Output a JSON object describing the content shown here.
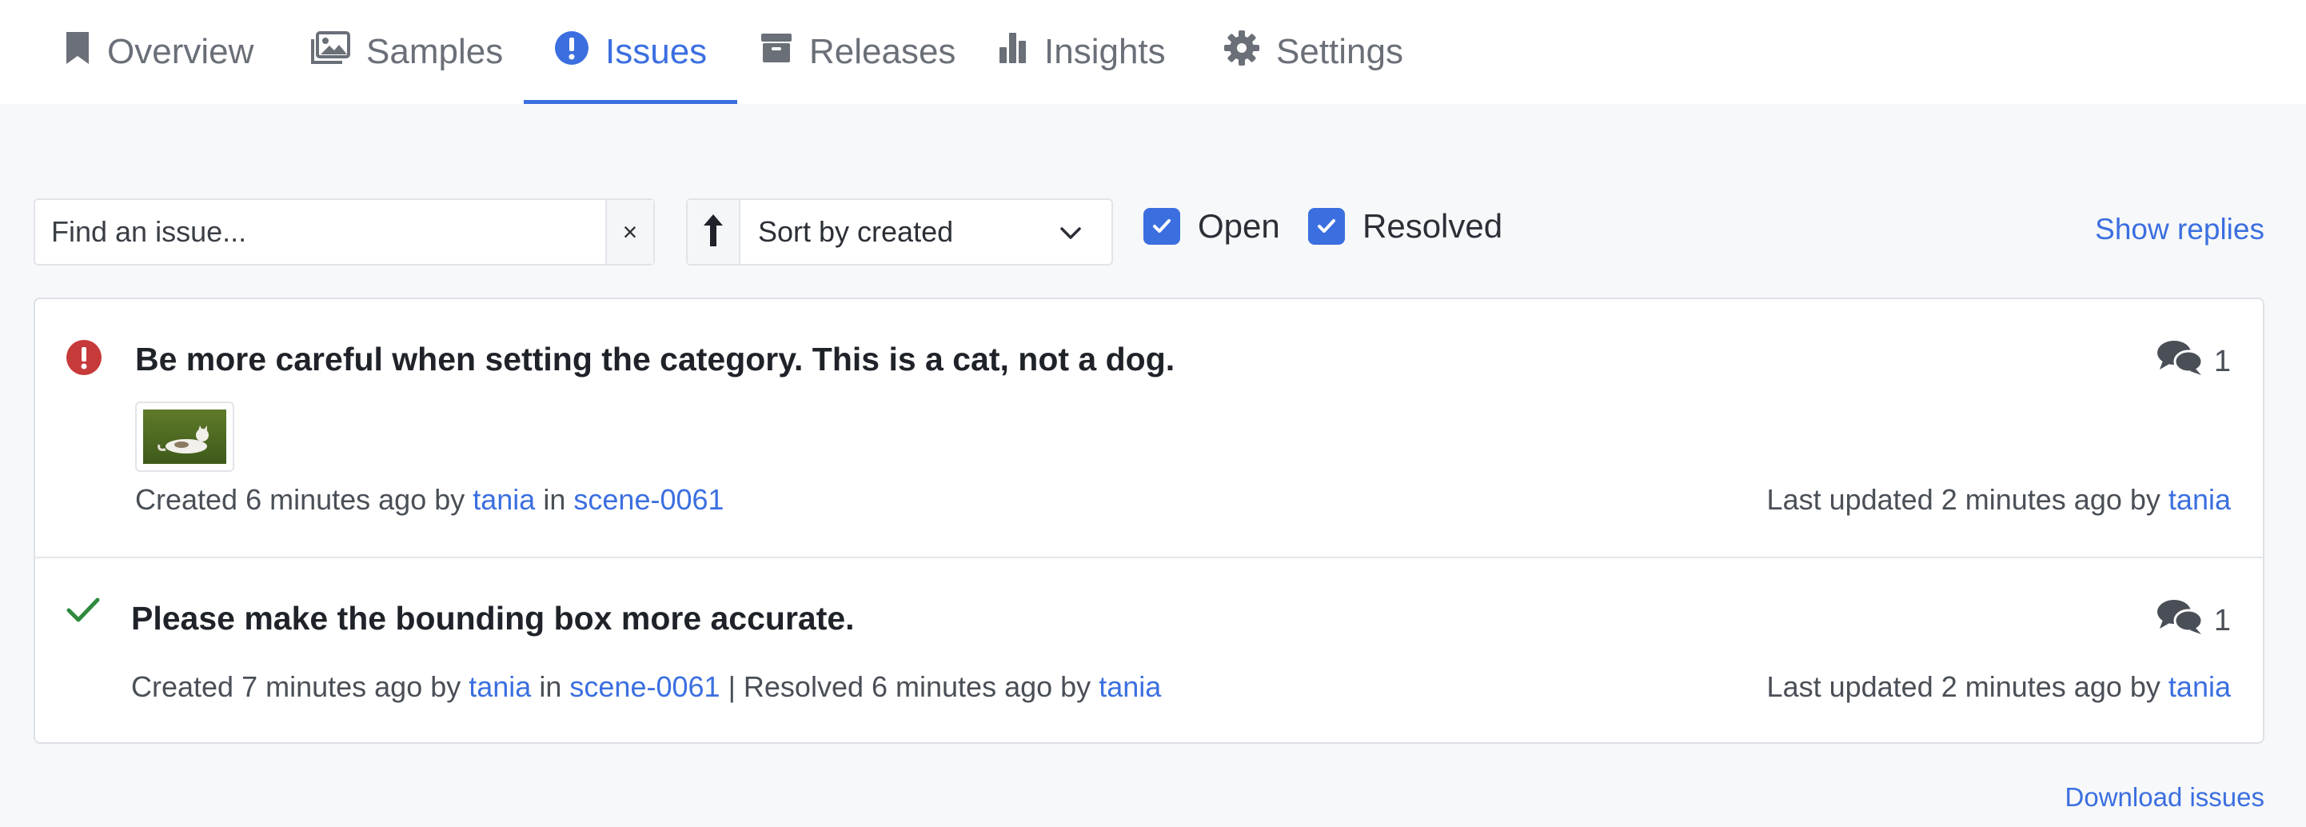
{
  "nav": {
    "tabs": [
      {
        "label": "Overview",
        "icon": "bookmark-icon"
      },
      {
        "label": "Samples",
        "icon": "images-icon"
      },
      {
        "label": "Issues",
        "icon": "exclamation-circle-icon",
        "active": true
      },
      {
        "label": "Releases",
        "icon": "box-icon"
      },
      {
        "label": "Insights",
        "icon": "bar-chart-icon"
      },
      {
        "label": "Settings",
        "icon": "gear-icon"
      }
    ]
  },
  "filters": {
    "search_placeholder": "Find an issue...",
    "clear_symbol": "×",
    "sort_label": "Sort by created",
    "open_label": "Open",
    "open_checked": true,
    "resolved_label": "Resolved",
    "resolved_checked": true,
    "show_replies": "Show replies"
  },
  "issues": [
    {
      "status": "open",
      "title": "Be more careful when setting the category. This is a cat, not a dog.",
      "replies": "1",
      "created_prefix": "Created 6 minutes ago by",
      "created_by": "tania",
      "in_word": "in",
      "scene": "scene-0061",
      "updated_prefix": "Last updated 2 minutes ago by",
      "updated_by": "tania"
    },
    {
      "status": "resolved",
      "title": "Please make the bounding box more accurate.",
      "replies": "1",
      "created_prefix": "Created 7 minutes ago by",
      "created_by": "tania",
      "in_word": "in",
      "scene": "scene-0061",
      "resolved_prefix": "| Resolved 6 minutes ago by",
      "resolved_by": "tania",
      "updated_prefix": "Last updated 2 minutes ago by",
      "updated_by": "tania"
    }
  ],
  "download": "Download issues",
  "colors": {
    "accent": "#3b6fe0",
    "error": "#c73a3a",
    "success": "#2f8a3e"
  }
}
